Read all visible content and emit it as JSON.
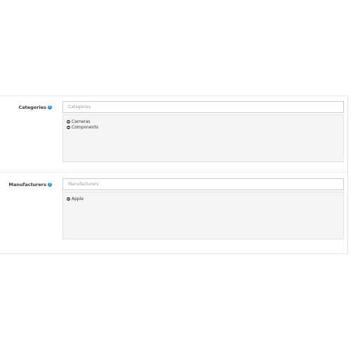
{
  "categories": {
    "label": "Categories",
    "input_placeholder": "Categories",
    "items": [
      "Cameras",
      "Components"
    ]
  },
  "manufacturers": {
    "label": "Manufacturers",
    "input_placeholder": "Manufacturers",
    "items": [
      "Apple"
    ]
  },
  "colors": {
    "help_icon": "#1e91cf",
    "well_background": "#f5f5f5"
  }
}
